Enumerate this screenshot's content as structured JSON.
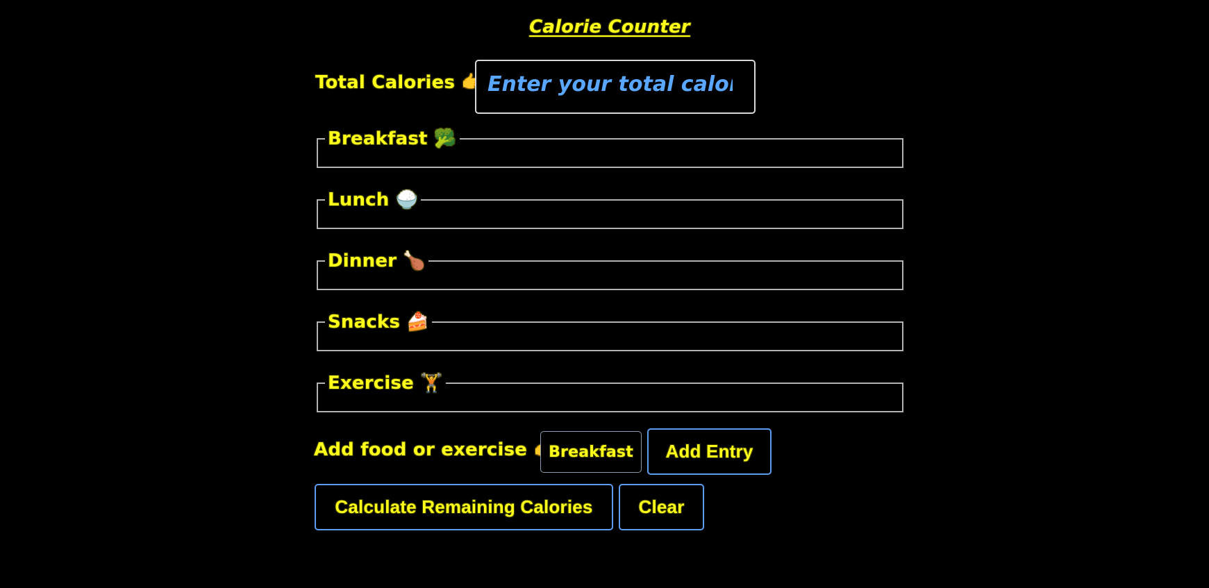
{
  "page": {
    "title": "Calorie Counter"
  },
  "budget": {
    "label": "Total Calories 👉",
    "placeholder": "Enter your total calories"
  },
  "sections": [
    {
      "legend": "Breakfast 🥦"
    },
    {
      "legend": "Lunch 🍚"
    },
    {
      "legend": "Dinner 🍗"
    },
    {
      "legend": "Snacks 🍰"
    },
    {
      "legend": "Exercise 🏋️"
    }
  ],
  "entry": {
    "label": "Add food or exercise 👉",
    "selected_option": "Breakfast",
    "add_button_label": "Add Entry"
  },
  "actions": {
    "calculate_label": "Calculate Remaining Calories",
    "clear_label": "Clear"
  },
  "colors": {
    "background": "#000000",
    "text_yellow": "#ffff1a",
    "placeholder_blue": "#5aa7ff",
    "button_border_blue": "#5c9ded",
    "fieldset_border": "#b3b3b3"
  }
}
